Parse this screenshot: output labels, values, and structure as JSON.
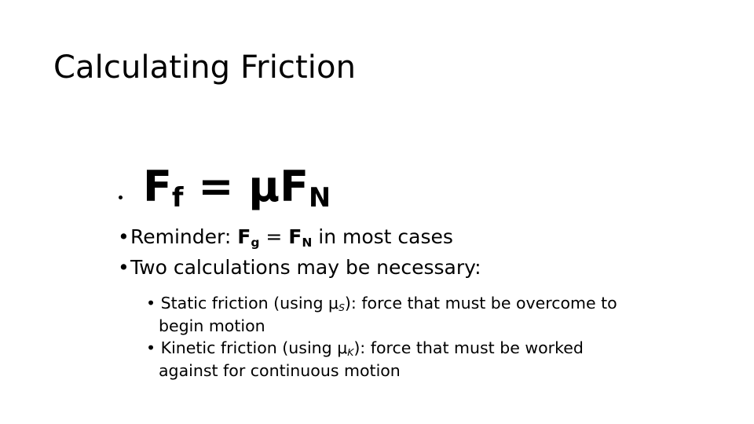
{
  "slide": {
    "title": "Calculating Friction",
    "background_color": "#FFFFFF",
    "text_color": "#000000"
  },
  "content": {
    "formula": {
      "bullet": "•",
      "left": "F",
      "left_subscript": "f",
      "operator": " = ",
      "right_mu": "μ",
      "right_force": "F",
      "right_subscript": "N",
      "plain_text": "Ff = μFN"
    },
    "level2_bullets": [
      {
        "bullet": "•",
        "prefix": "Reminder: ",
        "sym1": "F",
        "sub1": "g",
        "middle": " = ",
        "sym2": "F",
        "sub2": "N",
        "suffix": " in most cases",
        "plain_text": "Reminder: Fg = FN in most cases"
      },
      {
        "bullet": "•",
        "text": "Two calculations may be necessary:",
        "plain_text": "Two calculations may be necessary:"
      }
    ],
    "level3_bullets": [
      {
        "bullet": "•",
        "prefix": "Static friction (using ",
        "mu": "μ",
        "subscript": "S",
        "suffix": "): force that must be overcome to begin motion",
        "plain_text": "Static friction (using μS): force that must be overcome to begin motion"
      },
      {
        "bullet": "•",
        "prefix": "Kinetic friction (using ",
        "mu": "μ",
        "subscript": "K",
        "suffix": "): force that must be worked against for continuous motion",
        "plain_text": "Kinetic friction (using μK): force that must be worked against for continuous motion"
      }
    ]
  }
}
